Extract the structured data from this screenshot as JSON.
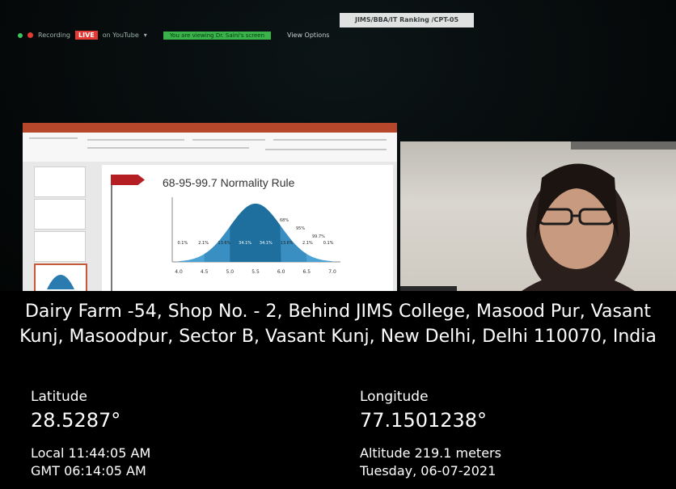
{
  "zoom_bar": {
    "recording_label": "Recording",
    "live_badge": "LIVE",
    "live_on": "on YouTube",
    "banner_text": "You are viewing Dr. Saini's screen",
    "view_options": "View Options"
  },
  "meeting_title": "JIMS/BBA/IT Ranking /CPT-05",
  "slide": {
    "title": "68-95-99.7 Normality Rule",
    "chart_data": {
      "type": "area",
      "x_ticks": [
        "4.0",
        "4.5",
        "5.0",
        "5.5",
        "6.0",
        "6.5",
        "7.0"
      ],
      "region_labels": [
        "0.1%",
        "2.1%",
        "13.6%",
        "34.1%",
        "34.1%",
        "13.6%",
        "2.1%",
        "0.1%"
      ],
      "callouts": [
        "68%",
        "95%",
        "99.7%"
      ]
    }
  },
  "location": {
    "address": "Dairy Farm -54, Shop No. - 2, Behind JIMS College, Masood Pur, Vasant Kunj, Masoodpur, Sector B, Vasant Kunj, New Delhi, Delhi 110070, India",
    "latitude_label": "Latitude",
    "latitude_value": "28.5287°",
    "longitude_label": "Longitude",
    "longitude_value": "77.1501238°",
    "local_time": "Local 11:44:05 AM",
    "gmt_time": "GMT 06:14:05 AM",
    "altitude": "Altitude 219.1 meters",
    "date": "Tuesday, 06-07-2021"
  },
  "colors": {
    "bell_dark": "#1f6f9e",
    "bell_light": "#4aa3d4",
    "accent_red": "#b51f24",
    "live_red": "#e53935",
    "banner_green": "#39b34a"
  }
}
